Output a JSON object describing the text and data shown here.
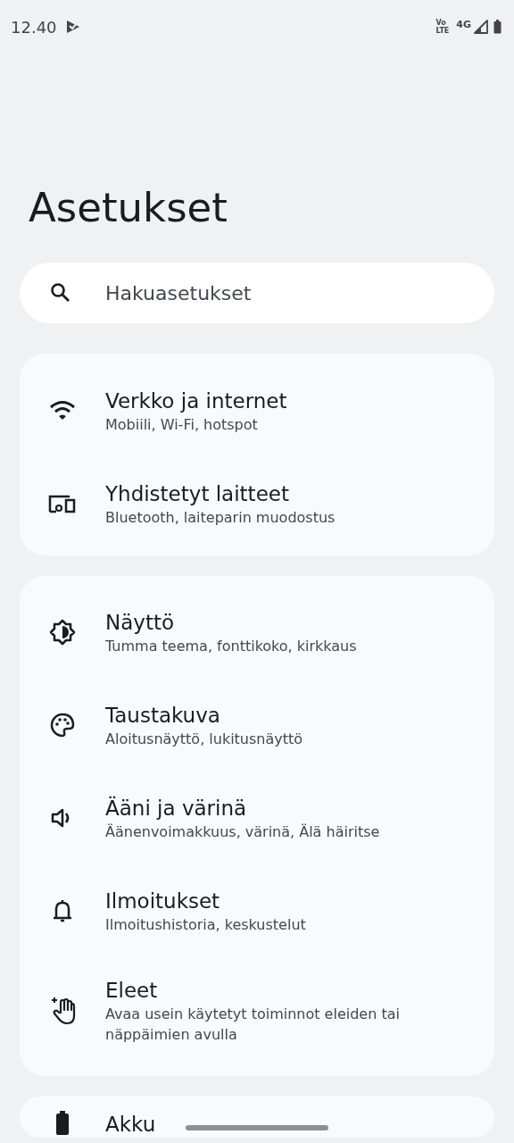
{
  "status_bar": {
    "time": "12.40",
    "volte_top": "Vo",
    "volte_bottom": "LTE",
    "network": "4G"
  },
  "title": "Asetukset",
  "search": {
    "placeholder": "Hakuasetukset"
  },
  "groups": [
    {
      "items": [
        {
          "title": "Verkko ja internet",
          "subtitle": "Mobiili, Wi-Fi, hotspot"
        },
        {
          "title": "Yhdistetyt laitteet",
          "subtitle": "Bluetooth, laiteparin muodostus"
        }
      ]
    },
    {
      "items": [
        {
          "title": "Näyttö",
          "subtitle": "Tumma teema, fonttikoko, kirkkaus"
        },
        {
          "title": "Taustakuva",
          "subtitle": "Aloitusnäyttö, lukitusnäyttö"
        },
        {
          "title": "Ääni ja värinä",
          "subtitle": "Äänenvoimakkuus, värinä, Älä häiritse"
        },
        {
          "title": "Ilmoitukset",
          "subtitle": "Ilmoitushistoria, keskustelut"
        },
        {
          "title": "Eleet",
          "subtitle": "Avaa usein käytetyt toiminnot eleiden tai näppäimien avulla"
        }
      ]
    },
    {
      "items": [
        {
          "title": "Akku"
        }
      ]
    }
  ]
}
